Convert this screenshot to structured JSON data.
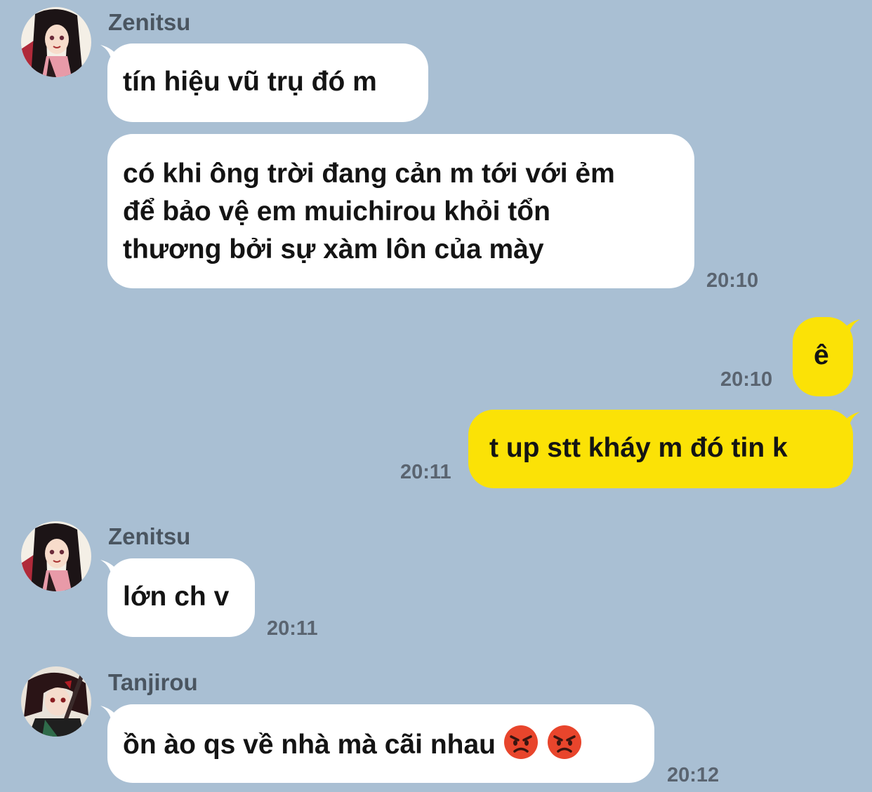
{
  "theme": {
    "background": "#a9bfd3",
    "incoming_bubble": "#ffffff",
    "outgoing_bubble": "#fbe206",
    "angry_emoji": "#e8452c"
  },
  "messages": [
    {
      "sender": "Zenitsu",
      "text": "tín hiệu vũ trụ đó m",
      "direction": "incoming"
    },
    {
      "sender": "Zenitsu",
      "lines": [
        "có khi ông trời đang cản m tới với ẻm",
        "để bảo vệ em muichirou khỏi tổn",
        "thương bởi sự xàm lôn của mày"
      ],
      "time": "20:10",
      "direction": "incoming"
    },
    {
      "text": "ê",
      "time": "20:10",
      "direction": "outgoing"
    },
    {
      "text": "t up stt kháy m đó tin k",
      "time": "20:11",
      "direction": "outgoing"
    },
    {
      "sender": "Zenitsu",
      "text": "lớn ch v",
      "time": "20:11",
      "direction": "incoming"
    },
    {
      "sender": "Tanjirou",
      "text": "ồn ào qs về nhà mà cãi nhau",
      "emojis": [
        "angry-face",
        "angry-face"
      ],
      "time": "20:12",
      "direction": "incoming"
    }
  ]
}
